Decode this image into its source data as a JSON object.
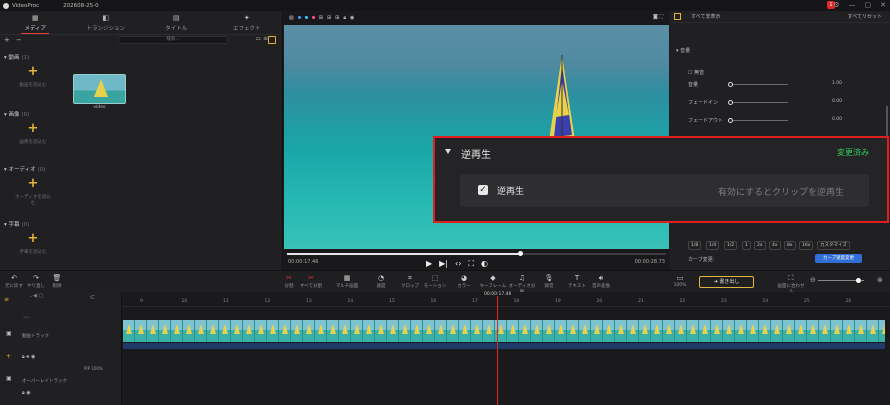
{
  "titlebar": {
    "app": "VideoProc",
    "project": "202608-25-0",
    "badge": "1"
  },
  "left": {
    "tabs": [
      {
        "label": "メディア",
        "icon": "media-icon"
      },
      {
        "label": "トランジション",
        "icon": "transition-icon"
      },
      {
        "label": "タイトル",
        "icon": "title-icon"
      },
      {
        "label": "エフェクト",
        "icon": "effect-icon"
      }
    ],
    "search_placeholder": "検索...",
    "sections": [
      {
        "name": "動画",
        "count": "(1)",
        "add": "動画を読込む"
      },
      {
        "name": "画像",
        "count": "(0)",
        "add": "画像を読込む"
      },
      {
        "name": "オーディオ",
        "count": "(0)",
        "add": "オーディオを読込む"
      },
      {
        "name": "字幕",
        "count": "(0)",
        "add": "字幕を読込む"
      }
    ],
    "thumb_label": "video"
  },
  "preview": {
    "current_time": "00:00:17.46",
    "duration": "00:00:28.73",
    "progress": 0.61
  },
  "right": {
    "header": "すべて非表示",
    "reset": "すべてリセット",
    "volume_title": "音量",
    "mute": "無音",
    "volume": "音量",
    "volume_value": "1.00",
    "fade_in": "フェードイン",
    "fade_in_value": "0.00",
    "fade_out": "フェードアウト",
    "fade_out_value": "0.00",
    "speeds": [
      "1/8",
      "1/4",
      "1/2",
      "1",
      "2x",
      "4x",
      "8x",
      "16x",
      "カスタマイズ"
    ],
    "curve_label": "カーブ変更:",
    "curve_button": "カーブ速度変更"
  },
  "reverse": {
    "title": "逆再生",
    "changed": "変更済み",
    "checkbox_label": "逆再生",
    "description": "有効にするとクリップを逆再生"
  },
  "toolbar": {
    "undo": "元に戻す",
    "redo": "やり直し",
    "delete": "削除",
    "split": "分割",
    "split_all": "すべて分割",
    "multi": "マルチ画面",
    "speed": "速度",
    "crop": "クロップ",
    "motion": "モーション",
    "color": "カラー",
    "keyframe": "キーフレーム",
    "audio_split": "オーディオ分離",
    "record": "録音",
    "text": "テキスト",
    "tts": "音声変換",
    "quality": "100%",
    "export": "書き出し",
    "fit": "画面に合わせる"
  },
  "timeline": {
    "ticks": [
      "9",
      "10",
      "11",
      "12",
      "13",
      "14",
      "15",
      "16",
      "17",
      "18",
      "19",
      "20",
      "21",
      "22",
      "23",
      "24",
      "25",
      "26"
    ],
    "playhead": "00:00:17.46",
    "video_track": "動画トラック",
    "overlay_track": "オーバーレイトラック",
    "pip": "PIP",
    "pip_pct": "100%"
  }
}
